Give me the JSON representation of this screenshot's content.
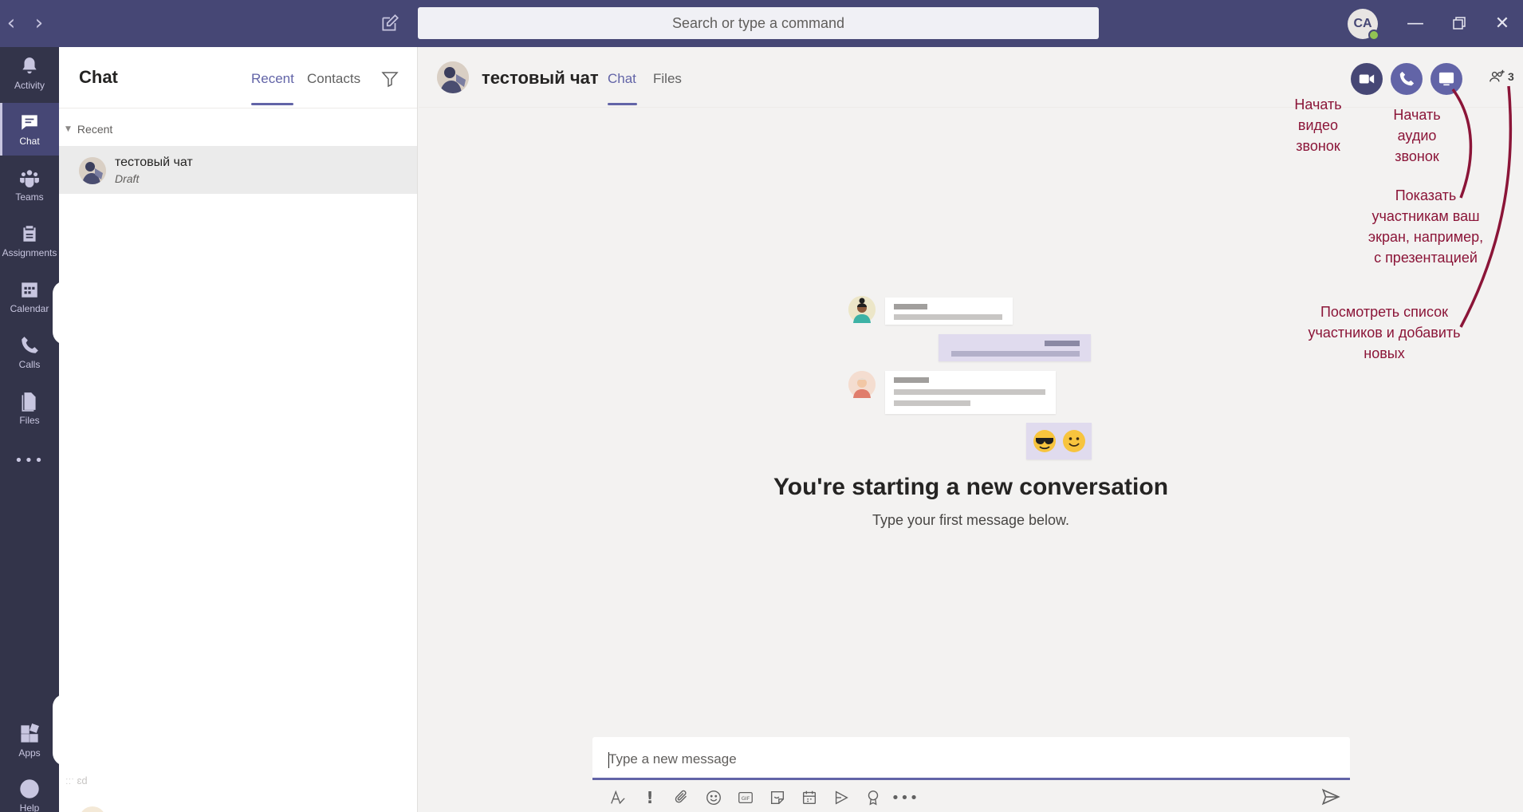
{
  "titlebar": {
    "back_icon": "chevron-left-icon",
    "forward_icon": "chevron-right-icon",
    "compose_icon": "compose-icon",
    "search_placeholder": "Search or type a command",
    "avatar_initials": "CA",
    "presence": "available",
    "window_controls": [
      "minimize-icon",
      "restore-icon",
      "close-icon"
    ]
  },
  "rail": {
    "items": [
      {
        "label": "Activity",
        "icon": "bell-icon"
      },
      {
        "label": "Chat",
        "icon": "chat-icon",
        "active": true
      },
      {
        "label": "Teams",
        "icon": "teams-icon"
      },
      {
        "label": "Assignments",
        "icon": "assignments-icon"
      },
      {
        "label": "Calendar",
        "icon": "calendar-icon"
      },
      {
        "label": "Calls",
        "icon": "phone-icon"
      },
      {
        "label": "Files",
        "icon": "file-icon"
      }
    ],
    "more_label": "•••",
    "bottom_items": [
      {
        "label": "Apps",
        "icon": "apps-icon"
      },
      {
        "label": "Help",
        "icon": "help-icon"
      }
    ]
  },
  "chat_list": {
    "title": "Chat",
    "tabs": [
      "Recent",
      "Contacts"
    ],
    "active_tab": "Recent",
    "filter_icon": "filter-icon",
    "section_label": "Recent",
    "items": [
      {
        "name": "тестовый чат",
        "preview": "Draft"
      }
    ],
    "faded_label": "ːːˑ ɛd"
  },
  "conversation": {
    "title": "тестовый чат",
    "tabs": [
      "Chat",
      "Files"
    ],
    "active_tab": "Chat",
    "participants_count": "3",
    "empty_title": "You're starting a new conversation",
    "empty_subtitle": "Type your first message below.",
    "composer_placeholder": "Type a new message",
    "toolbar_icons": [
      "format-icon",
      "important-icon",
      "attach-icon",
      "emoji-icon",
      "gif-icon",
      "sticker-icon",
      "meeting-icon",
      "stream-icon",
      "praise-icon",
      "more-icon"
    ],
    "send_icon": "send-icon"
  },
  "annotations": {
    "video": "Начать\nвидео\nзвонок",
    "audio": "Начать\nаудио\nзвонок",
    "share": "Показать\nучастникам ваш\nэкран, например,\nс презентацией",
    "participants": "Посмотреть список\nучастников и добавить\nновых"
  },
  "colors": {
    "brand": "#6264a7",
    "titlebar": "#464775",
    "rail": "#33344a",
    "annotation": "#8b1538"
  }
}
